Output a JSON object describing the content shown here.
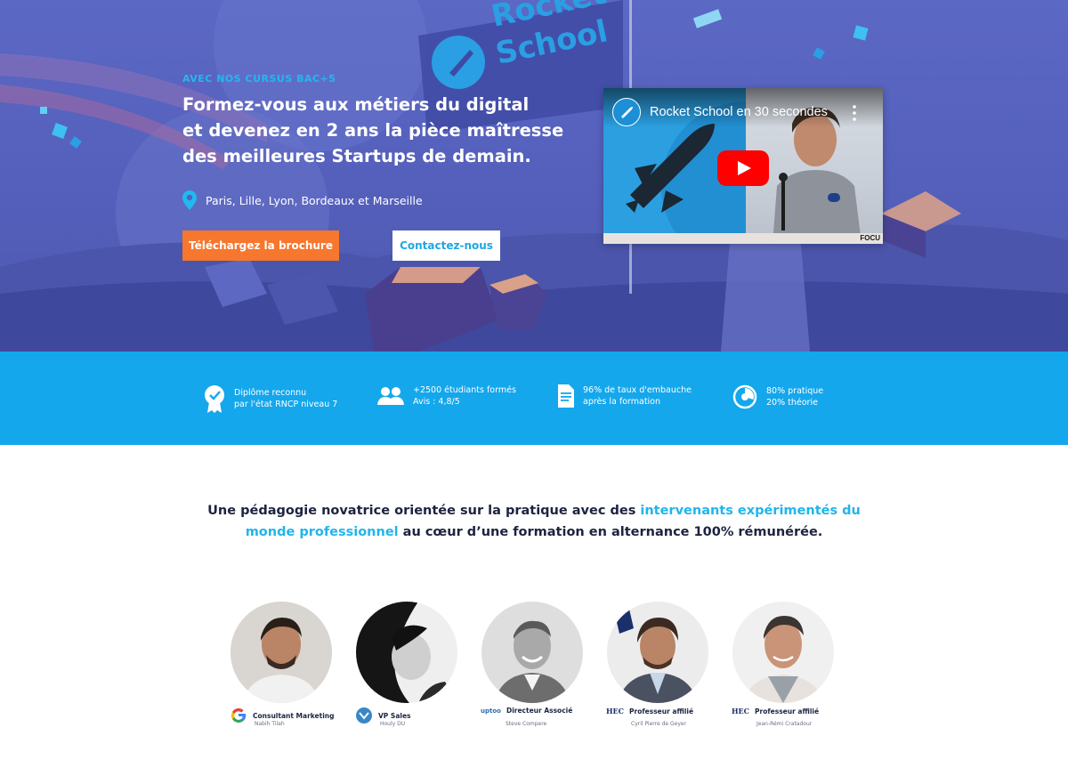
{
  "hero": {
    "kicker": "AVEC NOS CURSUS BAC+5",
    "headline_lines": [
      "Formez-vous aux métiers du digital",
      "et devenez en 2 ans la pièce maîtresse",
      "des meilleures Startups de demain."
    ],
    "locations": "Paris, Lille, Lyon, Bordeaux et Marseille",
    "brochure_button": "Téléchargez la brochure",
    "contact_button": "Contactez-nous",
    "banner_text": [
      "Rocket",
      "School"
    ]
  },
  "video": {
    "title": "Rocket School en 30 secondes",
    "corner_tag": "FOCU"
  },
  "stats": [
    {
      "icon": "certificate-icon",
      "line1": "Diplôme reconnu",
      "line2": "par l'état RNCP niveau 7"
    },
    {
      "icon": "students-icon",
      "line1": "+2500 étudiants formés",
      "line2": "Avis : 4,8/5"
    },
    {
      "icon": "document-icon",
      "line1": "96% de taux d'embauche",
      "line2": "après la formation"
    },
    {
      "icon": "pie-chart-icon",
      "line1": "80% pratique",
      "line2": "20% théorie"
    }
  ],
  "pedagogy": {
    "line1_a": "Une pédagogie novatrice orientée sur la pratique avec des ",
    "line1_b": "intervenants expérimentés du",
    "line2_a": "monde professionnel",
    "line2_b": " au cœur d’une formation en alternance 100% rémunérée."
  },
  "speakers": [
    {
      "role": "Consultant Marketing",
      "name": "Nabih Tilah",
      "company": "google-logo"
    },
    {
      "role": "VP Sales",
      "name": "Houly DU",
      "company": "company-logo"
    },
    {
      "role": "Directeur Associé",
      "name": "Steve Compere",
      "company": "uptoo-logo",
      "company_text": "uptoo"
    },
    {
      "role": "Professeur affilié",
      "name": "Cyril Pierre de Geyer",
      "company": "hec-logo",
      "company_text": "HEC"
    },
    {
      "role": "Professeur affilié",
      "name": "Jean-Rémi Cratadour",
      "company": "hec-logo",
      "company_text": "HEC"
    }
  ],
  "colors": {
    "hero_blue": "#5561bd",
    "accent_cyan": "#14a7ec",
    "cta_orange": "#f6772d",
    "text_dark": "#1d2340"
  }
}
